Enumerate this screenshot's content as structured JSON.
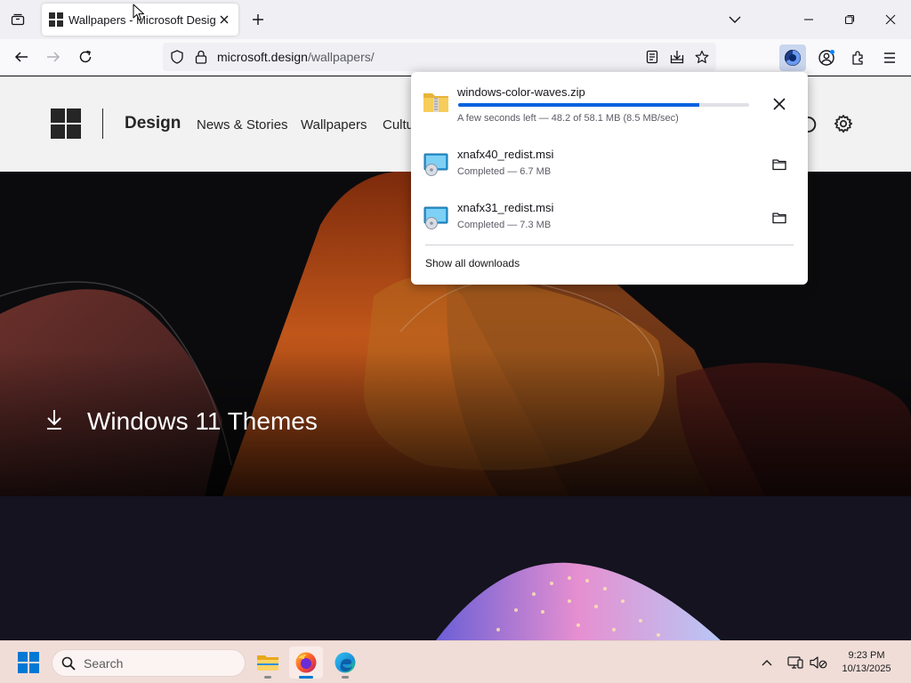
{
  "browser": {
    "tab": {
      "title": "Wallpapers - Microsoft Design"
    },
    "url": {
      "domain": "microsoft.design",
      "path": "/wallpapers/"
    }
  },
  "site": {
    "brand": "Design",
    "nav": [
      "News & Stories",
      "Wallpapers",
      "Cultu"
    ]
  },
  "hero": {
    "title": "Windows 11 Themes"
  },
  "downloads": {
    "items": [
      {
        "name": "windows-color-waves.zip",
        "status": "A few seconds left — 48.2 of 58.1 MB (8.5 MB/sec)",
        "progress": 0.83,
        "icon": "zip-folder-icon",
        "action": "cancel"
      },
      {
        "name": "xnafx40_redist.msi",
        "status": "Completed — 6.7 MB",
        "icon": "installer-icon",
        "action": "show-in-folder"
      },
      {
        "name": "xnafx31_redist.msi",
        "status": "Completed — 7.3 MB",
        "icon": "installer-icon",
        "action": "show-in-folder"
      }
    ],
    "show_all": "Show all downloads"
  },
  "taskbar": {
    "search_placeholder": "Search",
    "time": "9:23 PM",
    "date": "10/13/2025"
  },
  "colors": {
    "accent": "#0061e0",
    "windows_blue": "#0078d4",
    "taskbar_bg": "#f0ddd8"
  }
}
